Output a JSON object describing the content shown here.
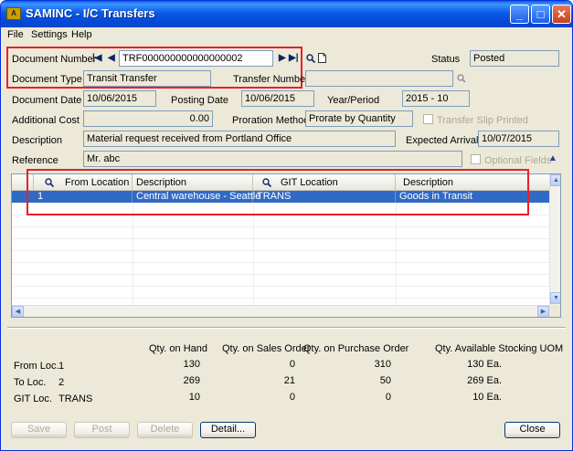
{
  "window": {
    "title": "SAMINC - I/C Transfers",
    "app_icon_text": "A",
    "minimize": "_",
    "maximize": "□",
    "close": "✕"
  },
  "menu": [
    "File",
    "Settings",
    "Help"
  ],
  "header": {
    "document_number_label": "Document Number",
    "document_number": "TRF000000000000000002",
    "status_label": "Status",
    "status": "Posted",
    "document_type_label": "Document Type",
    "document_type": "Transit Transfer",
    "transfer_number_label": "Transfer Number",
    "transfer_number": "",
    "document_date_label": "Document Date",
    "document_date": "10/06/2015",
    "posting_date_label": "Posting Date",
    "posting_date": "10/06/2015",
    "year_period_label": "Year/Period",
    "year_period": "2015 - 10",
    "additional_cost_label": "Additional Cost",
    "additional_cost": "0.00",
    "proration_method_label": "Proration Method",
    "proration_method": "Prorate by Quantity",
    "transfer_slip_label": "Transfer Slip Printed",
    "description_label": "Description",
    "description": "Material request received from Portland Office",
    "expected_arrival_label": "Expected Arrival",
    "expected_arrival": "10/07/2015",
    "reference_label": "Reference",
    "reference": "Mr. abc",
    "optional_fields_label": "Optional Fields"
  },
  "grid": {
    "columns": [
      "From Location",
      "Description",
      "GIT Location",
      "Description"
    ],
    "rows": [
      [
        "1",
        "Central warehouse - Seattle",
        "TRANS",
        "Goods in Transit"
      ]
    ]
  },
  "summary": {
    "headers": [
      "Qty. on Hand",
      "Qty. on Sales Order",
      "Qty. on Purchase Order",
      "Qty. Available Stocking UOM"
    ],
    "rows": [
      {
        "label": "From Loc.",
        "loc": "1",
        "on_hand": "130",
        "on_so": "0",
        "on_po": "310",
        "available": "130 Ea."
      },
      {
        "label": "To Loc.",
        "loc": "2",
        "on_hand": "269",
        "on_so": "21",
        "on_po": "50",
        "available": "269 Ea."
      },
      {
        "label": "GIT Loc.",
        "loc": "TRANS",
        "on_hand": "10",
        "on_so": "0",
        "on_po": "0",
        "available": "10 Ea."
      }
    ]
  },
  "buttons": {
    "save": "Save",
    "post": "Post",
    "delete": "Delete",
    "detail": "Detail...",
    "close": "Close"
  },
  "colors": {
    "highlight_box": "#e8202a",
    "selection": "#316ac5",
    "titlebar": "#0a5ae6"
  }
}
